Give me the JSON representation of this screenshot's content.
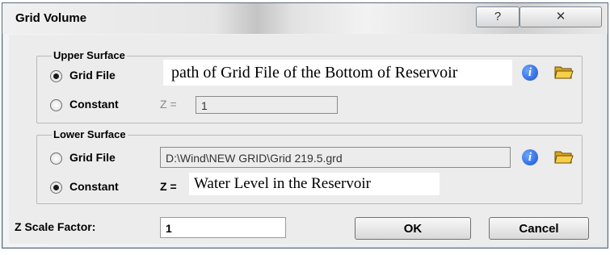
{
  "window": {
    "title": "Grid Volume",
    "help_glyph": "?",
    "close_glyph": "✕"
  },
  "upper": {
    "legend": "Upper Surface",
    "grid_file_label": "Grid File",
    "grid_file_value": "path of Grid File of the Bottom of Reservoir",
    "constant_label": "Constant",
    "z_label": "Z =",
    "z_value": "1",
    "selected": "grid_file"
  },
  "lower": {
    "legend": "Lower Surface",
    "grid_file_label": "Grid File",
    "grid_file_value": "D:\\Wind\\NEW GRID\\Grid 219.5.grd",
    "constant_label": "Constant",
    "z_label": "Z =",
    "z_value": "Water Level in the Reservoir",
    "selected": "constant"
  },
  "zscale": {
    "label": "Z Scale Factor:",
    "value": "1"
  },
  "buttons": {
    "ok": "OK",
    "cancel": "Cancel"
  },
  "icons": {
    "info": "info-icon",
    "open_folder": "open-folder-icon"
  }
}
